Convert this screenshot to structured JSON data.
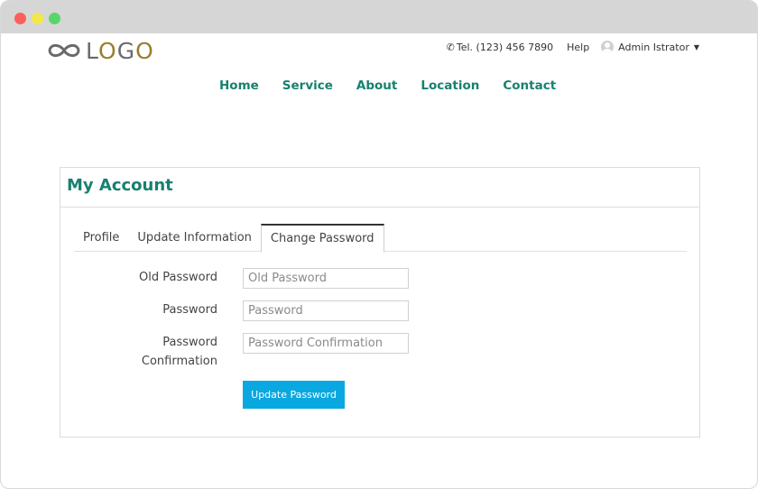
{
  "logo": {
    "text_prefix": "L",
    "text_o1": "O",
    "text_g": "G",
    "text_o2": "O",
    "icon": "infinity-icon"
  },
  "header": {
    "phone": {
      "icon": "phone-icon",
      "text": "Tel. (123) 456 7890"
    },
    "help": "Help",
    "user": {
      "name": "Admin Istrator",
      "icon": "avatar-icon",
      "caret_icon": "caret-down-icon"
    }
  },
  "nav": {
    "items": [
      "Home",
      "Service",
      "About",
      "Location",
      "Contact"
    ]
  },
  "account": {
    "title": "My Account",
    "tabs": [
      {
        "label": "Profile",
        "active": false
      },
      {
        "label": "Update Information",
        "active": false
      },
      {
        "label": "Change Password",
        "active": true
      }
    ],
    "form": {
      "fields": [
        {
          "label": "Old Password",
          "placeholder": "Old Password"
        },
        {
          "label": "Password",
          "placeholder": "Password"
        },
        {
          "label_line1": "Password",
          "label_line2": "Confirmation",
          "placeholder": "Password Confirmation"
        }
      ],
      "submit_label": "Update Password"
    }
  },
  "colors": {
    "accent": "#17816f",
    "button": "#0aa8e0",
    "titlebar": "#d6d6d6"
  }
}
